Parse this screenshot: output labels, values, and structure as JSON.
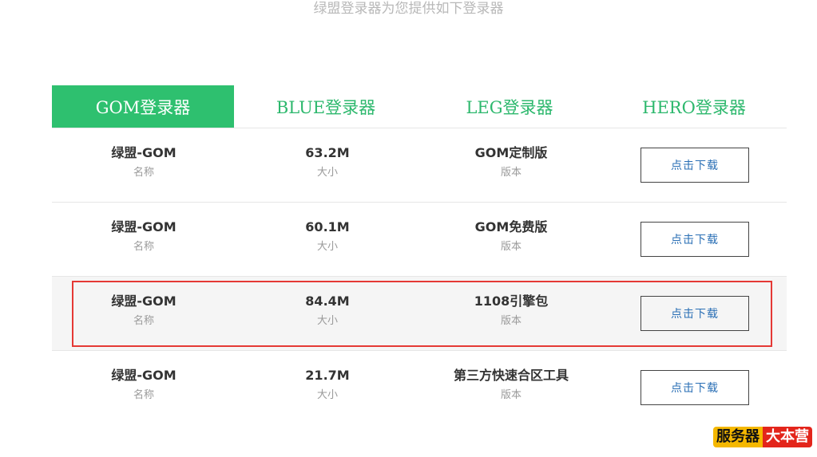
{
  "header": {
    "subtitle": "绿盟登录器为您提供如下登录器"
  },
  "tabs": [
    {
      "label": "GOM登录器",
      "active": true
    },
    {
      "label": "BLUE登录器",
      "active": false
    },
    {
      "label": "LEG登录器",
      "active": false
    },
    {
      "label": "HERO登录器",
      "active": false
    }
  ],
  "labels": {
    "name": "名称",
    "size": "大小",
    "version": "版本"
  },
  "rows": [
    {
      "name": "绿盟-GOM",
      "size": "63.2M",
      "version": "GOM定制版",
      "button": "点击下载"
    },
    {
      "name": "绿盟-GOM",
      "size": "60.1M",
      "version": "GOM免费版",
      "button": "点击下载"
    },
    {
      "name": "绿盟-GOM",
      "size": "84.4M",
      "version": "1108引擎包",
      "button": "点击下载",
      "highlighted": true
    },
    {
      "name": "绿盟-GOM",
      "size": "21.7M",
      "version": "第三方快速合区工具",
      "button": "点击下载"
    }
  ],
  "watermark": {
    "part1": "服务器",
    "part2": "大本营"
  },
  "colors": {
    "accent": "#2ec06f",
    "highlight_border": "#e53935",
    "button_text": "#2a6fb5"
  }
}
